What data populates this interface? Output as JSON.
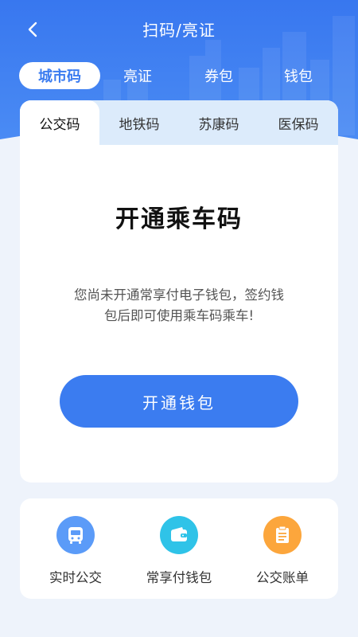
{
  "header": {
    "title": "扫码/亮证",
    "back_icon": "chevron-left-icon"
  },
  "main_tabs": [
    {
      "label": "城市码",
      "active": true
    },
    {
      "label": "亮证",
      "active": false
    },
    {
      "label": "券包",
      "active": false
    },
    {
      "label": "钱包",
      "active": false
    }
  ],
  "sub_tabs": [
    {
      "label": "公交码",
      "active": true
    },
    {
      "label": "地铁码",
      "active": false
    },
    {
      "label": "苏康码",
      "active": false
    },
    {
      "label": "医保码",
      "active": false
    }
  ],
  "card": {
    "heading": "开通乘车码",
    "desc_line1": "您尚未开通常享付电子钱包，签约钱",
    "desc_line2": "包后即可使用乘车码乘车!",
    "button_label": "开通钱包"
  },
  "quick_actions": [
    {
      "label": "实时公交",
      "icon": "bus-icon",
      "color": "#5b9bf8"
    },
    {
      "label": "常享付钱包",
      "icon": "wallet-icon",
      "color": "#2fc3e8"
    },
    {
      "label": "公交账单",
      "icon": "bill-icon",
      "color": "#fca63c"
    }
  ],
  "colors": {
    "primary": "#3b7cf0",
    "header_bg": "#3a7bf0",
    "page_bg": "#eef3fb",
    "sub_tab_bg": "#dcebfb"
  }
}
